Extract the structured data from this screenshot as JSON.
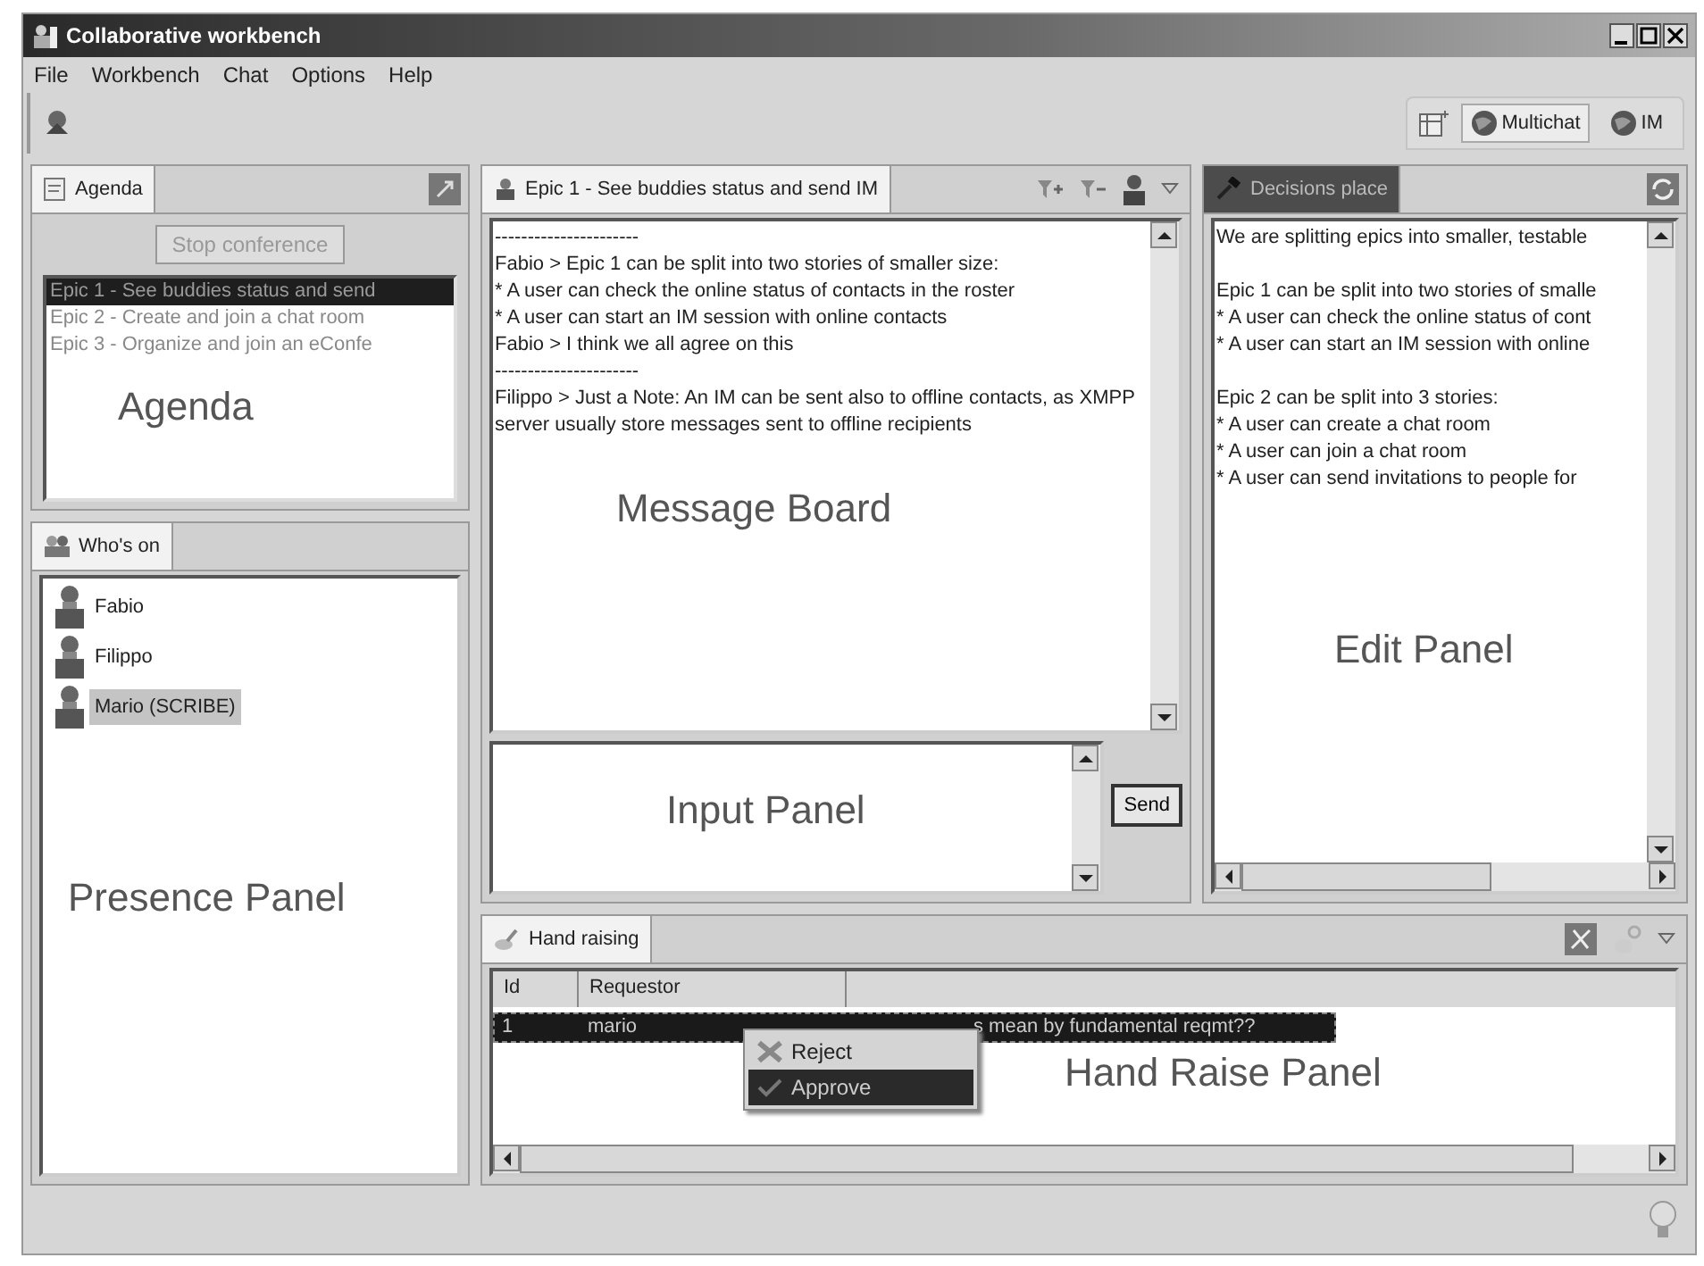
{
  "window": {
    "title": "Collaborative workbench"
  },
  "menu": [
    "File",
    "Workbench",
    "Chat",
    "Options",
    "Help"
  ],
  "perspectives": [
    {
      "label": "Multichat",
      "selected": true
    },
    {
      "label": "IM",
      "selected": false
    }
  ],
  "agenda": {
    "tab": {
      "label": "Agenda",
      "selected": false
    },
    "stop_button": {
      "label": "Stop conference",
      "disabled": true
    },
    "items": [
      {
        "label": "Epic 1 - See buddies status and send",
        "selected": true
      },
      {
        "label": "Epic 2 - Create and join a chat room",
        "selected": false
      },
      {
        "label": "Epic 3 - Organize and join an eConfe",
        "selected": false
      }
    ],
    "annotation": "Agenda"
  },
  "presence": {
    "tab": {
      "label": "Who's on",
      "selected": false
    },
    "users": [
      {
        "name": "Fabio",
        "selected": false
      },
      {
        "name": "Filippo",
        "selected": false
      },
      {
        "name": "Mario (SCRIBE)",
        "selected": true
      }
    ],
    "annotation": "Presence Panel"
  },
  "message_board": {
    "tab": {
      "label": "Epic 1 - See buddies status and send IM",
      "selected": false
    },
    "lines": [
      "----------------------",
      "Fabio > Epic 1 can be split into two stories of smaller size:",
      "* A user can check the online status of contacts in the roster",
      "* A user can start an IM session with online contacts",
      "Fabio > I think we all agree on this",
      "----------------------",
      "Filippo > Just a Note: An IM can be sent also to offline contacts, as XMPP server usually store messages sent to offline recipients"
    ],
    "annotation": "Message Board"
  },
  "input": {
    "annotation": "Input Panel",
    "send_button": "Send"
  },
  "decisions": {
    "tab": {
      "label": "Decisions place",
      "selected": true
    },
    "paragraphs": [
      [
        "We are splitting epics into smaller, testable"
      ],
      [
        "Epic 1 can be split into two stories of smalle",
        "* A user can check the online status of cont",
        "* A user can start an IM session with online"
      ],
      [
        "Epic 2 can be split into 3 stories:",
        "* A user can create a chat room",
        "* A user can join a chat room",
        "* A user can send invitations to people for"
      ]
    ],
    "annotation": "Edit Panel"
  },
  "hand_raising": {
    "tab": {
      "label": "Hand raising",
      "selected": false
    },
    "columns": [
      "Id",
      "Requestor"
    ],
    "rows": [
      {
        "id": "1",
        "requestor": "mario",
        "column_3": "s mean by fundamental reqmt??",
        "selected": true
      }
    ],
    "context_menu": [
      {
        "label": "Reject",
        "selected": false
      },
      {
        "label": "Approve",
        "selected": true
      }
    ],
    "annotation": "Hand Raise Panel"
  }
}
